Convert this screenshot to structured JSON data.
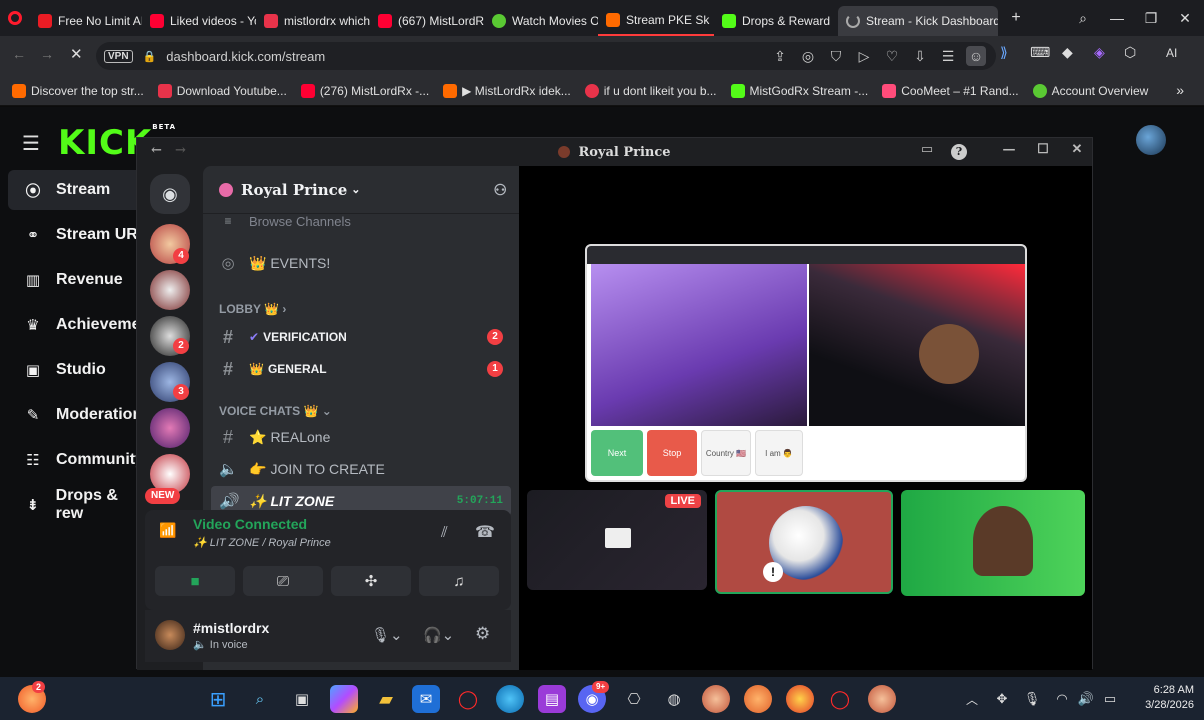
{
  "browser": {
    "tabs": [
      {
        "label": "Free No Limit AI I",
        "color": "#ea1c24"
      },
      {
        "label": "Liked videos - Yo",
        "color": "#ff0033"
      },
      {
        "label": "mistlordrx which",
        "color": "#e8334a"
      },
      {
        "label": "(667) MistLordR",
        "color": "#ff0033"
      },
      {
        "label": "Watch Movies Or",
        "color": "#5ac933"
      },
      {
        "label": "Stream PKE Sk",
        "color": "#ff6a00"
      },
      {
        "label": "Drops & Reward",
        "color": "#53fc18"
      },
      {
        "label": "Stream - Kick Dashboard",
        "color": "#888888"
      }
    ],
    "new_tab": "+",
    "url": "dashboard.kick.com/stream",
    "vpn_label": "VPN",
    "ai_label": "AI",
    "bookmarks": [
      {
        "label": "Discover the top str...",
        "color": "#ff6a00"
      },
      {
        "label": "Download Youtube...",
        "color": "#e8334a"
      },
      {
        "label": "(276) MistLordRx -...",
        "color": "#ff0033"
      },
      {
        "label": "▶ MistLordRx idek...",
        "color": "#ff6a00"
      },
      {
        "label": "if u dont likeit you b...",
        "color": "#e8334a"
      },
      {
        "label": "MistGodRx Stream -...",
        "color": "#53fc18"
      },
      {
        "label": "CooMeet – #1 Rand...",
        "color": "#ff4c7a"
      },
      {
        "label": "Account Overview",
        "color": "#5ac933"
      }
    ],
    "bookmarks_more": "»"
  },
  "kick": {
    "logo": "KICK",
    "logo_tag": "BETA",
    "nav": [
      {
        "label": "Stream",
        "icon": "broadcast-icon"
      },
      {
        "label": "Stream URL",
        "icon": "link-icon"
      },
      {
        "label": "Revenue",
        "icon": "chart-icon"
      },
      {
        "label": "Achieveme",
        "icon": "trophy-icon"
      },
      {
        "label": "Studio",
        "icon": "studio-icon"
      },
      {
        "label": "Moderation",
        "icon": "wrench-icon"
      },
      {
        "label": "Community",
        "icon": "community-icon"
      },
      {
        "label": "Drops & rew",
        "icon": "drops-icon"
      }
    ]
  },
  "discord": {
    "title": "Royal Prince",
    "server_name": "Royal Prince",
    "browse_channels": "Browse Channels",
    "events_label": "👑 EVENTS!",
    "lobby_category": "LOBBY 👑",
    "voice_category": "VOICE CHATS 👑",
    "channels": [
      {
        "name": "VERIFICATION",
        "emoji": "✔",
        "badge": "2"
      },
      {
        "name": "GENERAL",
        "emoji": "👑",
        "badge": "1"
      }
    ],
    "voice_channels": [
      {
        "name": "REALone",
        "emoji": "⭐"
      },
      {
        "name": "JOIN TO CREATE",
        "emoji": "👉"
      },
      {
        "name": "LIT ZONE",
        "emoji": "✨",
        "timer": "5:07:11"
      }
    ],
    "guild_badges": [
      "4",
      "2",
      "3"
    ],
    "new_label": "NEW",
    "voice_status": "Video Connected",
    "voice_location": "✨ LIT ZONE / Royal Prince",
    "username": "#mistlordrx",
    "user_status": "In voice",
    "live_label": "LIVE",
    "stream_buttons": [
      "Next",
      "Stop",
      "Country 🇺🇸",
      "I am 👨"
    ]
  },
  "taskbar": {
    "time": "6:28 AM",
    "date": "3/28/2026",
    "weather_badge": "2",
    "discord_badge": "9+"
  }
}
